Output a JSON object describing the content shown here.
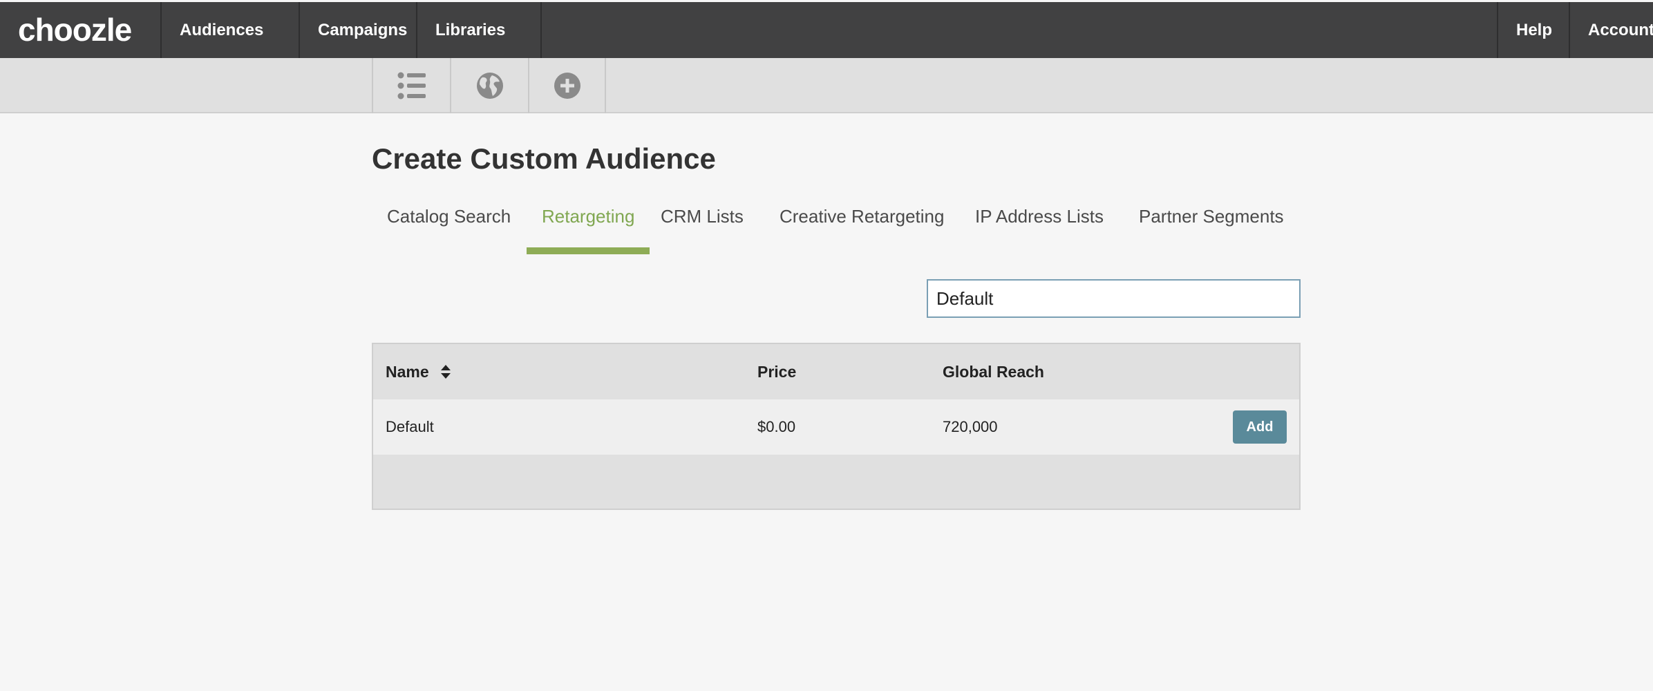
{
  "brand": {
    "logo_text": "choozle"
  },
  "topnav": {
    "items": [
      {
        "label": "Audiences",
        "has_dropdown": true
      },
      {
        "label": "Campaigns",
        "has_dropdown": false
      },
      {
        "label": "Libraries",
        "has_dropdown": true
      }
    ],
    "right_items": [
      {
        "label": "Help"
      },
      {
        "label": "Account:"
      }
    ]
  },
  "subbar": {
    "buttons": [
      {
        "icon": "list-icon"
      },
      {
        "icon": "globe-icon"
      },
      {
        "icon": "plus-circle-icon"
      }
    ]
  },
  "page": {
    "title": "Create Custom Audience"
  },
  "tabs": [
    {
      "label": "Catalog Search",
      "active": false
    },
    {
      "label": "Retargeting",
      "active": true
    },
    {
      "label": "CRM Lists",
      "active": false
    },
    {
      "label": "Creative Retargeting",
      "active": false
    },
    {
      "label": "IP Address Lists",
      "active": false
    },
    {
      "label": "Partner Segments",
      "active": false
    }
  ],
  "search": {
    "value": "Default"
  },
  "table": {
    "columns": [
      "Name",
      "Price",
      "Global Reach"
    ],
    "rows": [
      {
        "name": "Default",
        "price": "$0.00",
        "reach": "720,000",
        "action": "Add"
      }
    ]
  },
  "colors": {
    "nav_bg": "#414142",
    "accent_green": "#8eac56",
    "button_blue": "#5a8a9a"
  }
}
